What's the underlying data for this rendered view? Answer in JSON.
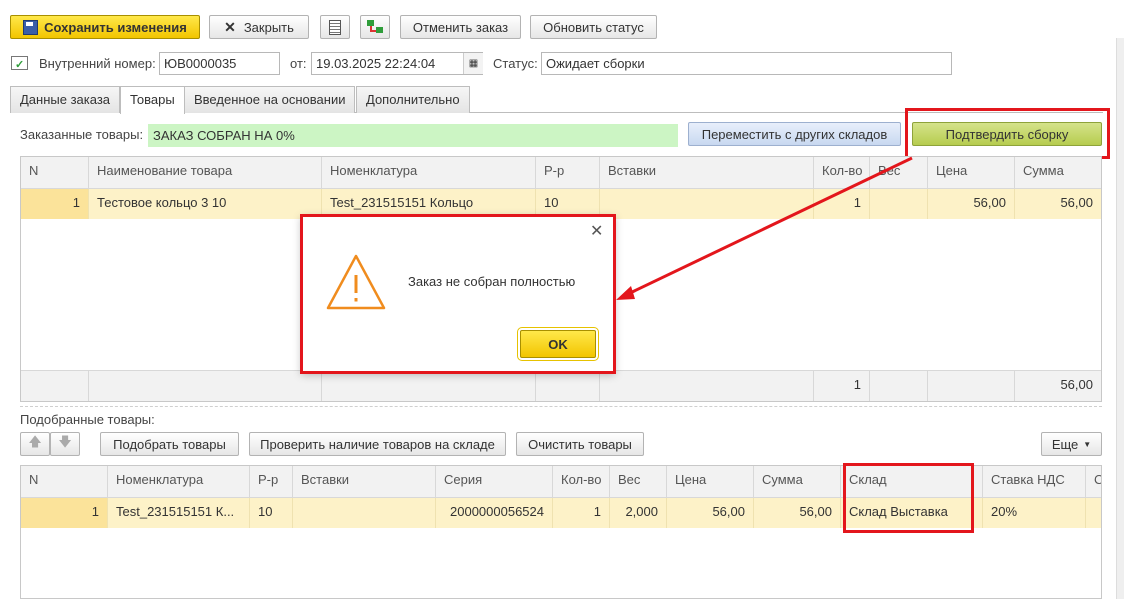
{
  "toolbar": {
    "save_label": "Сохранить изменения",
    "close_label": "Закрыть",
    "cancel_order_label": "Отменить заказ",
    "update_status_label": "Обновить статус"
  },
  "header": {
    "internal_number_label": "Внутренний номер:",
    "internal_number_value": "ЮВ0000035",
    "date_label": "от:",
    "date_value": "19.03.2025 22:24:04",
    "status_label": "Статус:",
    "status_value": "Ожидает сборки"
  },
  "tabs": [
    "Данные заказа",
    "Товары",
    "Введенное на основании",
    "Дополнительно"
  ],
  "ordered": {
    "label": "Заказанные товары:",
    "progress_text": "ЗАКАЗ СОБРАН НА 0%",
    "move_button": "Переместить с других складов",
    "confirm_button": "Подтвердить сборку",
    "columns": [
      "N",
      "Наименование товара",
      "Номенклатура",
      "Р-р",
      "Вставки",
      "Кол-во",
      "Вес",
      "Цена",
      "Сумма"
    ],
    "row": [
      "1",
      "Тестовое кольцо 3 10",
      "Test_231515151 Кольцо",
      "10",
      "",
      "1",
      "",
      "56,00",
      "56,00"
    ],
    "footer_qty": "1",
    "footer_sum": "56,00"
  },
  "dialog": {
    "message": "Заказ не собран полностью",
    "ok_label": "OK"
  },
  "picked": {
    "label": "Подобранные товары:",
    "pick_button": "Подобрать товары",
    "check_button": "Проверить наличие товаров на складе",
    "clear_button": "Очистить товары",
    "more_button": "Еще",
    "columns": [
      "N",
      "Номенклатура",
      "Р-р",
      "Вставки",
      "Серия",
      "Кол-во",
      "Вес",
      "Цена",
      "Сумма",
      "Склад",
      "Ставка НДС",
      "С"
    ],
    "row": [
      "1",
      "Test_231515151 К...",
      "10",
      "",
      "2000000056524",
      "1",
      "2,000",
      "56,00",
      "56,00",
      "Склад Выставка",
      "20%"
    ]
  },
  "colors": {
    "accent_red": "#e3161c",
    "row_highlight": "#fdf2c8",
    "progress_green": "#ccf5c4",
    "save_yellow": "#f2c500"
  }
}
